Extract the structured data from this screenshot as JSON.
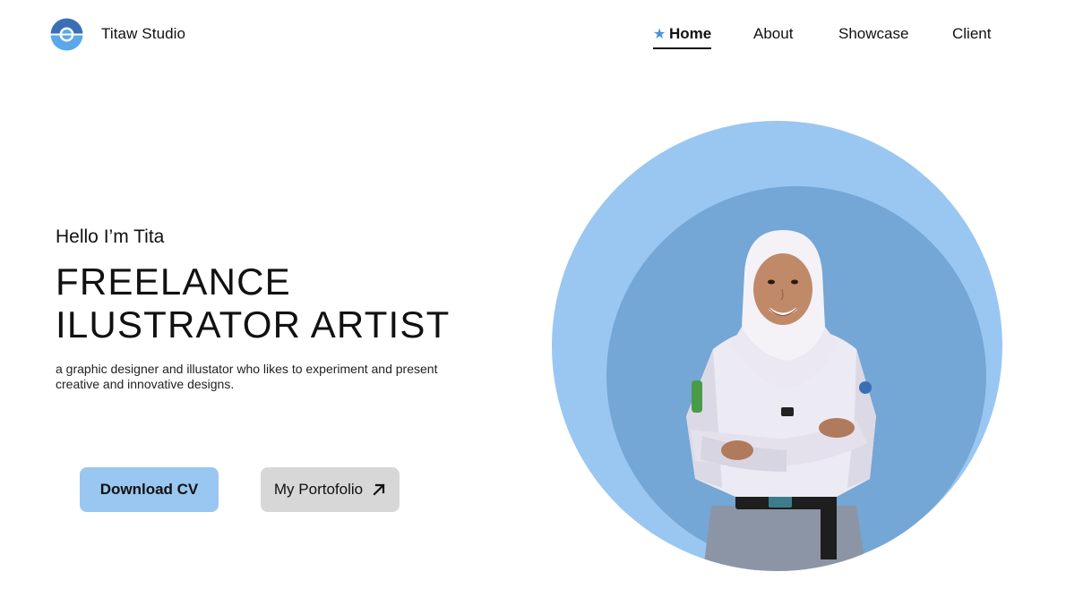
{
  "header": {
    "brand_name": "Titaw Studio",
    "logo_icon": "ring-logo-icon"
  },
  "nav": {
    "items": [
      {
        "label": "Home",
        "icon": "star-icon",
        "active": true
      },
      {
        "label": "About"
      },
      {
        "label": "Showcase"
      },
      {
        "label": "Client"
      }
    ]
  },
  "hero": {
    "greeting": "Hello I’m Tita",
    "headline_line1": "FREELANCE",
    "headline_line2": "ILUSTRATOR ARTIST",
    "description": "a graphic designer and illustator who likes to experiment and present creative and innovative designs.",
    "buttons": {
      "download_cv": "Download CV",
      "portfolio": "My Portofolio",
      "portfolio_icon": "arrow-up-right-icon"
    },
    "photo": {
      "subject": "portrait-photo"
    }
  },
  "colors": {
    "accent_light": "#99c7f1",
    "accent_mid": "#74a6d6",
    "logo_dark": "#3a6fb5",
    "logo_light": "#5aa7ea",
    "button_gray": "#d6d7d6",
    "star_blue": "#4a90d9"
  }
}
